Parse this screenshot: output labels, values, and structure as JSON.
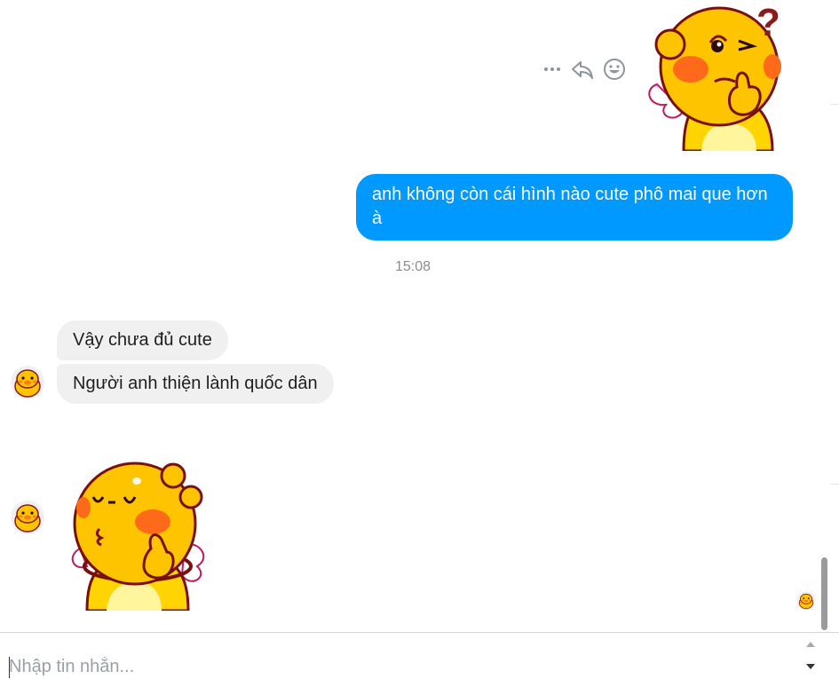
{
  "outgoing": {
    "text": "anh không còn cái hình nào cute phô mai que hơn à",
    "color": "#0099ff"
  },
  "timestamp": "15:08",
  "incoming": [
    "Vậy chưa đủ cute",
    "Người anh thiện lành quốc dân"
  ],
  "message_actions": [
    "more-icon",
    "reply-icon",
    "emoji-reaction-icon"
  ],
  "stickers": {
    "top": "thinking-question-sticker",
    "bottom": "shy-blushing-sticker"
  },
  "composer": {
    "placeholder": "Nhập tin nhắn..."
  }
}
